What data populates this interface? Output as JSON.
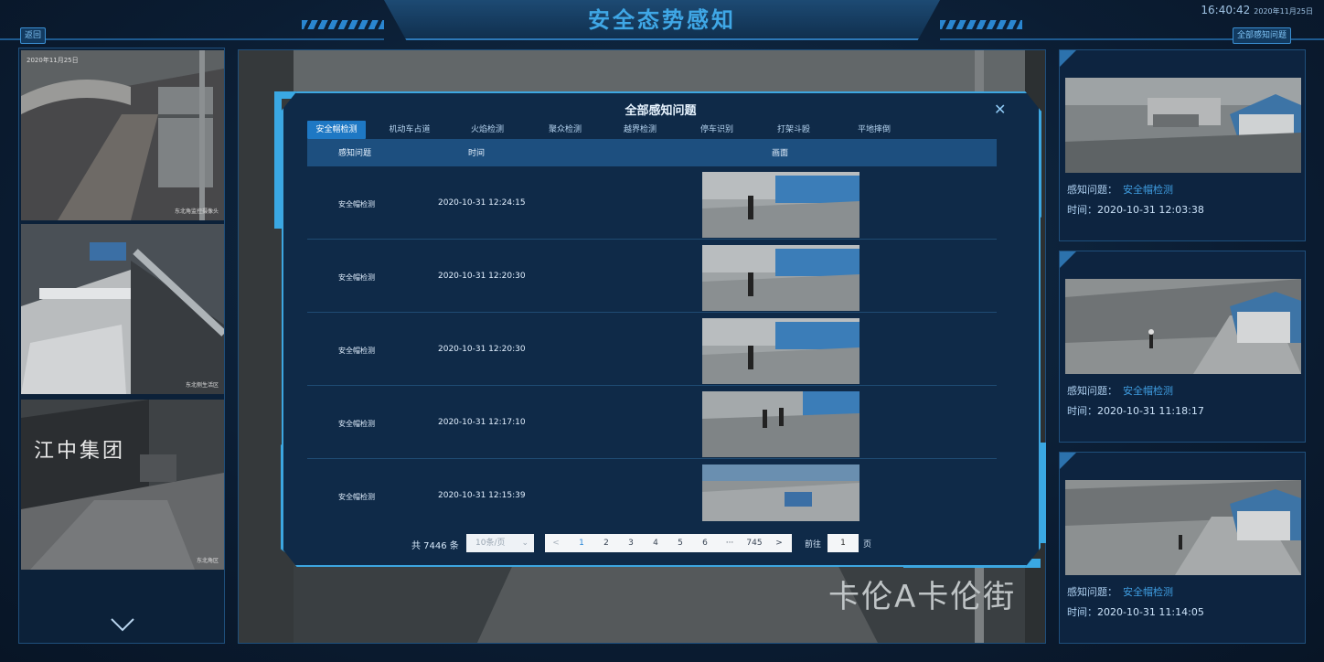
{
  "header": {
    "title": "安全态势感知",
    "time": "16:40:42",
    "date": "2020年11月25日",
    "back_label": "返回",
    "all_issues_label": "全部感知问题"
  },
  "left_cameras": [
    {
      "label": "2020年11月25日",
      "stamp": "东北角监控摄像头"
    },
    {
      "label": "",
      "stamp": "东北侧生活区"
    },
    {
      "label": "",
      "stamp": "东北角区"
    }
  ],
  "left_scene_text": "江中集团",
  "center": {
    "watermark": "卡伦A卡伦街"
  },
  "right_cards": [
    {
      "issue_label": "感知问题：",
      "issue_value": "安全帽检测",
      "time_label": "时间：",
      "time_value": "2020-10-31 12:03:38"
    },
    {
      "issue_label": "感知问题：",
      "issue_value": "安全帽检测",
      "time_label": "时间：",
      "time_value": "2020-10-31 11:18:17"
    },
    {
      "issue_label": "感知问题：",
      "issue_value": "安全帽检测",
      "time_label": "时间：",
      "time_value": "2020-10-31 11:14:05"
    }
  ],
  "modal": {
    "title": "全部感知问题",
    "tabs": [
      "安全帽检测",
      "机动车占道",
      "火焰检测",
      "聚众检测",
      "越界检测",
      "停车识别",
      "打架斗殴",
      "平地摔倒"
    ],
    "columns": [
      "感知问题",
      "时间",
      "画面"
    ],
    "rows": [
      {
        "type": "安全帽检测",
        "time": "2020-10-31 12:24:15"
      },
      {
        "type": "安全帽检测",
        "time": "2020-10-31 12:20:30"
      },
      {
        "type": "安全帽检测",
        "time": "2020-10-31 12:20:30"
      },
      {
        "type": "安全帽检测",
        "time": "2020-10-31 12:17:10"
      },
      {
        "type": "安全帽检测",
        "time": "2020-10-31 12:15:39"
      }
    ],
    "pager": {
      "total": "共 7446 条",
      "per_page": "10条/页",
      "prev": "<",
      "pages": [
        "1",
        "2",
        "3",
        "4",
        "5",
        "6",
        "···",
        "745"
      ],
      "next": ">",
      "goto_label": "前往",
      "goto_value": "1",
      "page_suffix": "页"
    }
  },
  "colors": {
    "accent": "#3da6e0",
    "title": "#3fa7e6",
    "panel": "#0f2a48",
    "highlight_text": "#3f9de0"
  }
}
